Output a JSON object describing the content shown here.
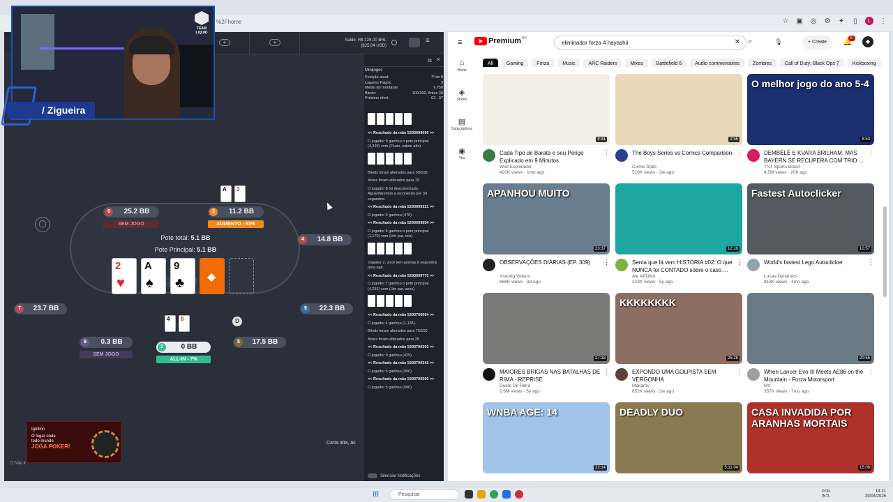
{
  "browser": {
    "url_fragment": "%2Fhome"
  },
  "stream_overlay": {
    "streamer_name": "/ Zigueira",
    "team_logo": "TEAM LIQUID",
    "ad_brand": "Ignition",
    "ad_line1": "O lugar onde",
    "ad_line2": "todo mundo",
    "ad_cta": "JOGA POKER!"
  },
  "poker": {
    "saldo_label": "Saldo:",
    "saldo_brl": "R$ 125,00 BRL",
    "saldo_usd": "($25.04 USD)",
    "pote_total_label": "Pote total:",
    "pote_total_value": "5.1 BB",
    "pote_principal_label": "Pote Principal:",
    "pote_principal_value": "5.1 BB",
    "watermark": "Ignition",
    "board": [
      {
        "rank": "2",
        "suit": "♥",
        "color": "red"
      },
      {
        "rank": "A",
        "suit": "♠",
        "color": "black"
      },
      {
        "rank": "9",
        "suit": "♣",
        "color": "black"
      }
    ],
    "seats": [
      {
        "num": "6",
        "stack": "25.2 BB",
        "status": "SEM JOGO"
      },
      {
        "num": "3",
        "stack": "11.2 BB",
        "status": "AUMENTO - 93%"
      },
      {
        "num": "4",
        "stack": "14.8 BB"
      },
      {
        "num": "7",
        "stack": "23.7 BB"
      },
      {
        "num": "9",
        "stack": "22.3 BB"
      },
      {
        "num": "8",
        "stack": "0.3 BB",
        "status": "SEM JOGO"
      },
      {
        "num": "2",
        "stack": "0 BB",
        "status": "ALL-IN - 7%"
      },
      {
        "num": "5",
        "stack": "17.5 BB"
      }
    ],
    "seat3_cards": [
      "A",
      "3"
    ],
    "seat2_cards": [
      "4",
      "8"
    ],
    "dealer": "D",
    "carta_alta": "Carta alta, ás",
    "nao_ir": "Não ir"
  },
  "side_panel": {
    "title": "Minijogos",
    "stats": [
      {
        "label": "Posição atual:",
        "value": "7º de 8"
      },
      {
        "label": "Lugares Pagos:",
        "value": "3"
      },
      {
        "label": "Média do montante:",
        "value": "9,750"
      },
      {
        "label": "Blinds:",
        "value": "100/200, Antes 30"
      },
      {
        "label": "Próximo nível:",
        "value": "02 : 37"
      }
    ],
    "history": [
      {
        "type": "cards"
      },
      {
        "type": "bold",
        "text": "<< Resultado da mão 5293699056 >>"
      },
      {
        "type": "text",
        "text": "O jogador 9 ganhou o pote principal (4,339) com (Flush, valete alto)."
      },
      {
        "type": "cards"
      },
      {
        "type": "text",
        "text": "Blinds foram alterados para 50/100"
      },
      {
        "type": "text",
        "text": "Antes foram alterados para 15"
      },
      {
        "type": "text",
        "text": "O jogador 8 foi desconectado. Aguardaremos a reconexão por 30 segundos."
      },
      {
        "type": "bold",
        "text": "<< Resultado da mão 5293699321 >>"
      },
      {
        "type": "text",
        "text": "O jogador 3 ganhou (470)."
      },
      {
        "type": "bold",
        "text": "<< Resultado da mão 5293699554 >>"
      },
      {
        "type": "text",
        "text": "O jogador 6 ganhou o pote principal (1,170) com (Um par, reis)."
      },
      {
        "type": "cards"
      },
      {
        "type": "text",
        "text": "Jogador 2, você tem apenas 8 segundos para agir."
      },
      {
        "type": "bold",
        "text": "<< Resultado da mão 5293699773 >>"
      },
      {
        "type": "text",
        "text": "O jogador 7 ganhou o pote principal (4,251) com (Um par, ases)."
      },
      {
        "type": "cards"
      },
      {
        "type": "bold",
        "text": "<< Resultado da mão 5293700064 >>"
      },
      {
        "type": "text",
        "text": "O jogador 4 ganhou (1,136)."
      },
      {
        "type": "text",
        "text": "Blinds foram alterados para 75/150"
      },
      {
        "type": "text",
        "text": "Antes foram alterados para 25"
      },
      {
        "type": "bold",
        "text": "<< Resultado da mão 5293700303 >>"
      },
      {
        "type": "text",
        "text": "O jogador 9 ganhou (425)."
      },
      {
        "type": "bold",
        "text": "<< Resultado da mão 5293700342 >>"
      },
      {
        "type": "text",
        "text": "O jogador 5 ganhou (950)."
      },
      {
        "type": "bold",
        "text": "<< Resultado da mão 5293700560 >>"
      },
      {
        "type": "text",
        "text": "O jogador 5 ganhou (500)."
      }
    ],
    "silenciar": "Silenciar Notificações"
  },
  "youtube": {
    "logo_word": "Premium",
    "logo_region": "BR",
    "search_value": "eliminador forza 4 hayashii",
    "create_label": "Create",
    "notif_count": "9+",
    "sidebar": [
      {
        "icon": "home-icon",
        "glyph": "⌂",
        "label": "Home"
      },
      {
        "icon": "shorts-icon",
        "glyph": "◈",
        "label": "Shorts"
      },
      {
        "icon": "subscriptions-icon",
        "glyph": "▤",
        "label": "Subscriptions"
      },
      {
        "icon": "you-icon",
        "glyph": "◉",
        "label": "You"
      }
    ],
    "chips": [
      "All",
      "Gaming",
      "Forza",
      "Music",
      "ARC Raiders",
      "Mixes",
      "Battlefield 6",
      "Audio commentaries",
      "Zombies",
      "Call of Duty: Black Ops 7",
      "Kickboxing"
    ],
    "videos": [
      {
        "title": "Cada Tipo de Barata e seu Perigo Explicado em 9 Minutos",
        "channel": "Wolf Explorador",
        "stats": "420K views · 1mo ago",
        "duration": "9:31",
        "thumb_color": "#f3efe6",
        "avatar_color": "#3a7d44",
        "caption": ""
      },
      {
        "title": "The Boys Series vs Comics Comparison",
        "channel": "Comic Stats",
        "stats": "519K views · 3w ago",
        "duration": "2:55",
        "thumb_color": "#e9d9b8",
        "avatar_color": "#2c3e8f",
        "caption": ""
      },
      {
        "title": "DEMBÉLÉ E KVARA BRILHAM, MAS BAYERN SE RECUPERA COM TRIO ...",
        "channel": "TNT Sports Brasil",
        "stats": "4.5M views · 20h ago",
        "duration": "8:53",
        "thumb_color": "#1b2f6e",
        "avatar_color": "#d81b60",
        "caption": "O melhor jogo do ano 5-4"
      },
      {
        "title": "OBSERVAÇÕES DIÁRIAS (EP. 309)",
        "channel": "Xracing Videos",
        "stats": "668K views · 9d ago",
        "duration": "23:37",
        "thumb_color": "#6a7d8e",
        "avatar_color": "#222222",
        "caption": "APANHOU MUITO"
      },
      {
        "title": "Senta que lá vem HISTÓRIA #02: O que NUNCA foi CONTADO sobre o caso ...",
        "channel": "Ale APOKA",
        "stats": "323K views · 5y ago",
        "duration": "12:10",
        "thumb_color": "#1fa6a0",
        "avatar_color": "#7cb342",
        "caption": ""
      },
      {
        "title": "World's fastest Lego Autoclicker",
        "channel": "Lucas-Dynamics",
        "stats": "818K views · 4mo ago",
        "duration": "10:57",
        "thumb_color": "#555a60",
        "avatar_color": "#90a4ae",
        "caption": "Fastest Autoclicker"
      },
      {
        "title": "MAIORES BRIGAS NAS BATALHAS DE RIMA - REPRISE",
        "channel": "Duelo De Rima",
        "stats": "2.6M views · 5y ago",
        "duration": "27:18",
        "thumb_color": "#7a7a78",
        "avatar_color": "#111111",
        "caption": ""
      },
      {
        "title": "EXPONDO UMA GOLPISTA SEM VERGONHA",
        "channel": "Makarov",
        "stats": "652K views · 2w ago",
        "duration": "25:28",
        "thumb_color": "#8d6e63",
        "avatar_color": "#5d4037",
        "caption": "KKKKKKKK"
      },
      {
        "title": "When Lancer Evo III Meets AE86 on the Mountain - Forza Motorsport",
        "channel": "MV",
        "stats": "357K views · 7mo ago",
        "duration": "20:55",
        "thumb_color": "#6b7b86",
        "avatar_color": "#9e9e9e",
        "caption": ""
      },
      {
        "title": "",
        "channel": "",
        "stats": "",
        "duration": "22:14",
        "thumb_color": "#a0c4e8",
        "avatar_color": "#cccccc",
        "caption": "WNBA  AGE: 14"
      },
      {
        "title": "",
        "channel": "",
        "stats": "",
        "duration": "5:11:04",
        "thumb_color": "#8a7a52",
        "avatar_color": "#cccccc",
        "caption": "DEADLY DUO"
      },
      {
        "title": "",
        "channel": "",
        "stats": "",
        "duration": "15:08",
        "thumb_color": "#b0302a",
        "avatar_color": "#cccccc",
        "caption": "CASA INVADIDA POR ARANHAS MORTAIS"
      }
    ]
  },
  "taskbar": {
    "search_placeholder": "Pesquisar",
    "lang1": "POR",
    "lang2": "INTL",
    "time": "14:21",
    "date": "29/04/2026"
  },
  "colors": {
    "accent_orange": "#f08a1c",
    "allin_green": "#2fbf8f",
    "sem_jogo_red": "#b54d57",
    "youtube_red": "#ff0000"
  }
}
